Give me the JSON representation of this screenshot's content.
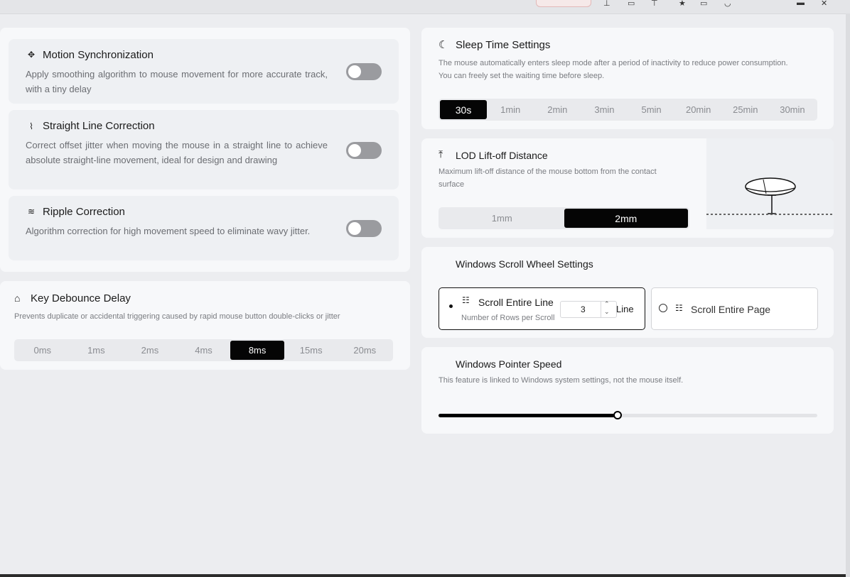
{
  "motion": {
    "title": "Motion Synchronization",
    "desc": "Apply smoothing algorithm to mouse movement for more accurate track, with a tiny delay",
    "enabled": false
  },
  "straight": {
    "title": "Straight Line Correction",
    "desc": "Correct offset jitter when moving the mouse in a straight line to achieve absolute straight-line movement, ideal for design and drawing",
    "enabled": false
  },
  "ripple": {
    "title": "Ripple Correction",
    "desc": "Algorithm correction for high movement speed to eliminate wavy jitter.",
    "enabled": false
  },
  "debounce": {
    "title": "Key Debounce Delay",
    "desc": "Prevents duplicate or accidental triggering caused by rapid mouse button double-clicks or jitter",
    "options": [
      "0ms",
      "1ms",
      "2ms",
      "4ms",
      "8ms",
      "15ms",
      "20ms"
    ],
    "selected": "8ms"
  },
  "sleep": {
    "title": "Sleep Time Settings",
    "desc_line1": "The mouse automatically enters sleep mode after a period of inactivity to reduce power consumption.",
    "desc_line2": "You can freely set the waiting time before sleep.",
    "options": [
      "30s",
      "1min",
      "2min",
      "3min",
      "5min",
      "20min",
      "25min",
      "30min"
    ],
    "selected": "30s"
  },
  "lod": {
    "title": "LOD Lift-off Distance",
    "desc_line1": "Maximum lift-off distance of the mouse bottom from the contact",
    "desc_line2": "surface",
    "options": [
      "1mm",
      "2mm"
    ],
    "selected": "2mm"
  },
  "scroll": {
    "title": "Windows Scroll Wheel Settings",
    "line_label": "Scroll Entire Line",
    "rows_label": "Number of Rows per Scroll",
    "rows_value": "3",
    "unit": "Line",
    "page_label": "Scroll Entire Page",
    "selected": "line"
  },
  "pointer": {
    "title": "Windows Pointer Speed",
    "desc": "This feature is linked to Windows system settings, not the mouse itself.",
    "value_fraction": 0.473
  }
}
